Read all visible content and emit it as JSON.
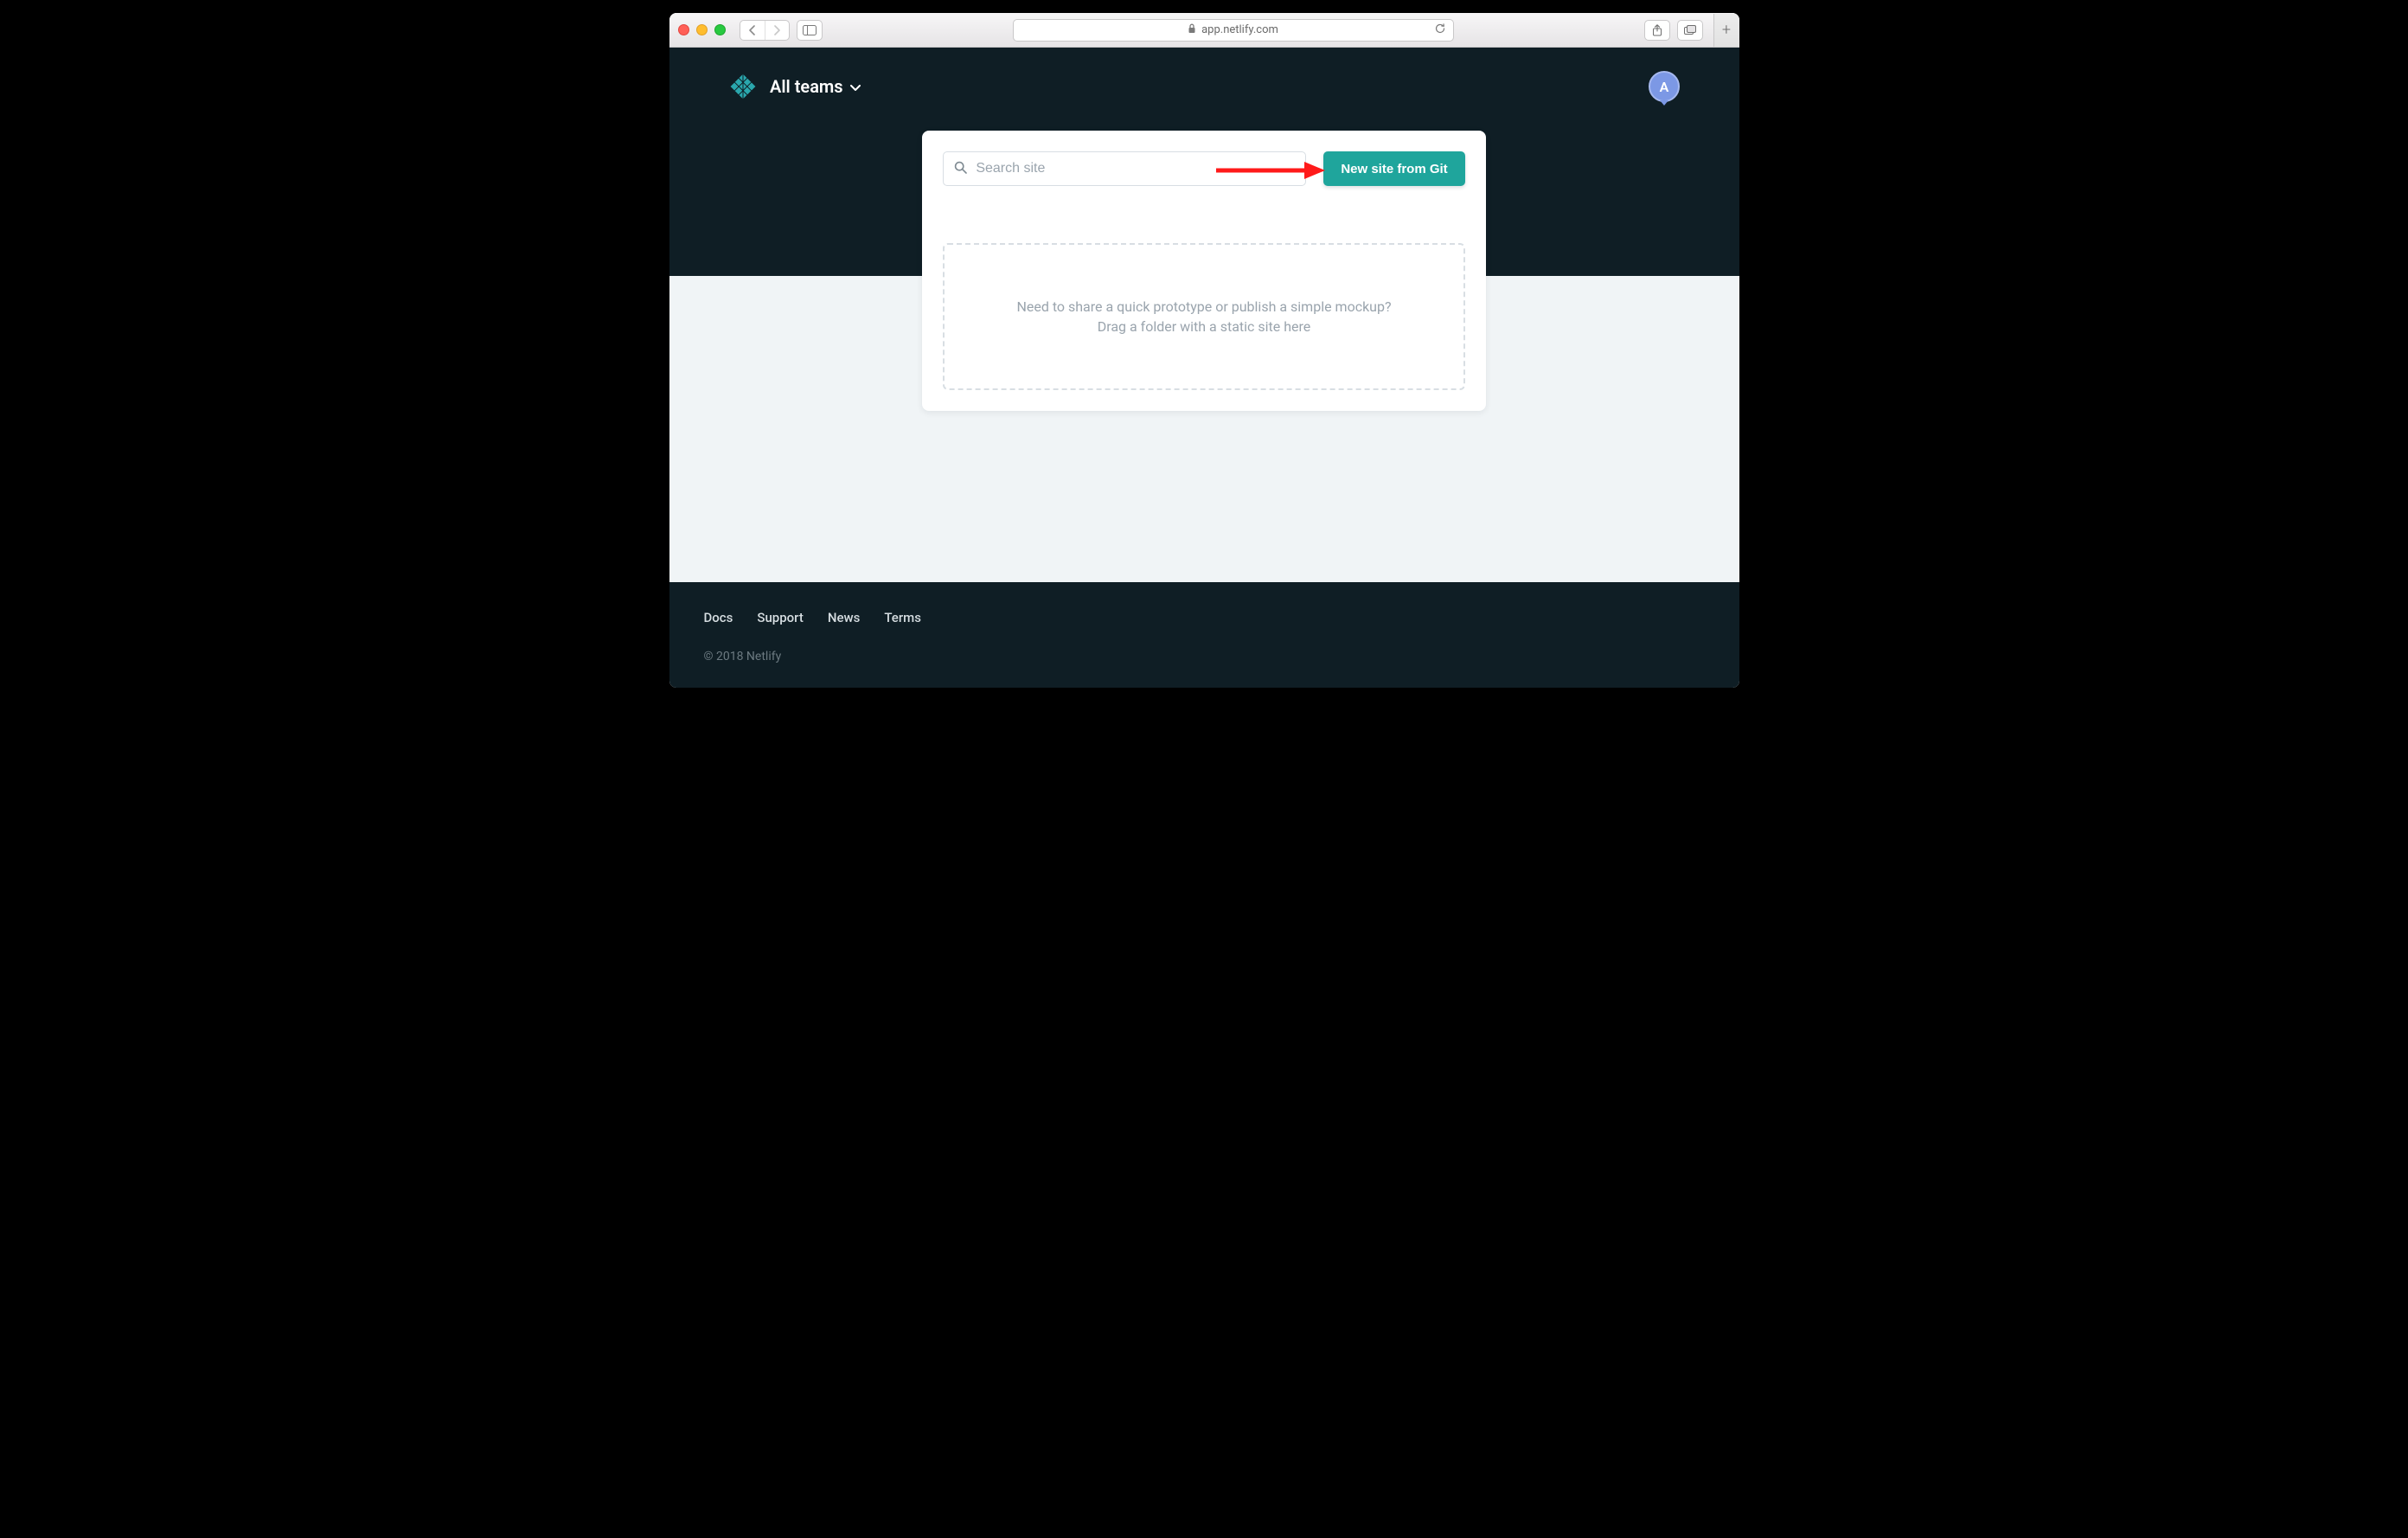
{
  "browser": {
    "address": "app.netlify.com"
  },
  "header": {
    "team_selector_label": "All teams",
    "avatar_initial": "A"
  },
  "main": {
    "search_placeholder": "Search site",
    "new_site_button_label": "New site from Git",
    "dropzone_line1": "Need to share a quick prototype or publish a simple mockup?",
    "dropzone_line2": "Drag a folder with a static site here"
  },
  "footer": {
    "links": [
      "Docs",
      "Support",
      "News",
      "Terms"
    ],
    "copyright": "© 2018 Netlify"
  },
  "colors": {
    "accent_teal": "#1fa59c",
    "header_dark": "#0f1e25",
    "page_bg": "#f0f4f6",
    "avatar_bg": "#7c98e5"
  }
}
